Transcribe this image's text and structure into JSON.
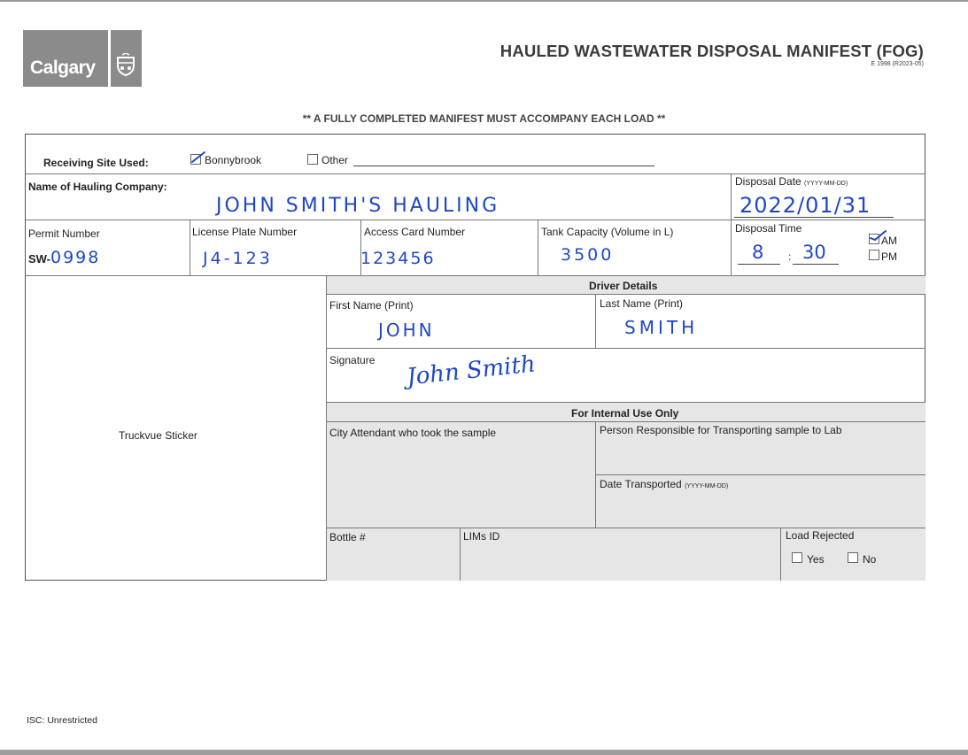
{
  "header": {
    "logo_text": "Calgary",
    "title": "HAULED WASTEWATER DISPOSAL MANIFEST (FOG)",
    "form_code": "E 1998 (R2023-05)",
    "notice": "** A FULLY COMPLETED MANIFEST MUST ACCOMPANY EACH LOAD **"
  },
  "receiving": {
    "label": "Receiving Site Used:",
    "option_bonnybrook": "Bonnybrook",
    "bonnybrook_checked": true,
    "option_other": "Other",
    "other_checked": false
  },
  "hauling": {
    "label": "Name of Hauling Company:",
    "value": "JOHN SMITH'S HAULING"
  },
  "disposal_date": {
    "label": "Disposal Date",
    "format": "(YYYY-MM-DD)",
    "value": "2022/01/31"
  },
  "permit": {
    "label": "Permit Number",
    "prefix": "SW-",
    "value": "0998"
  },
  "license": {
    "label": "License Plate Number",
    "value": "J4-123"
  },
  "access_card": {
    "label": "Access Card Number",
    "value": "123456"
  },
  "tank": {
    "label": "Tank Capacity (Volume in L)",
    "value": "3500"
  },
  "disposal_time": {
    "label": "Disposal Time",
    "hour": "8",
    "separator": ":",
    "minute": "30",
    "am_label": "AM",
    "pm_label": "PM",
    "am_checked": true
  },
  "truckvue": {
    "label": "Truckvue Sticker"
  },
  "driver": {
    "section_label": "Driver Details",
    "first_label": "First Name (Print)",
    "first_value": "JOHN",
    "last_label": "Last Name (Print)",
    "last_value": "SMITH",
    "signature_label": "Signature",
    "signature_value": "John Smith"
  },
  "internal": {
    "section_label": "For Internal Use Only",
    "attendant_label": "City Attendant who took the sample",
    "transport_label": "Person Responsible for Transporting sample to Lab",
    "date_transported_label": "Date Transported",
    "date_transported_format": "(YYYY-MM-DD)",
    "bottle_label": "Bottle #",
    "lims_label": "LIMs ID",
    "rejected_label": "Load Rejected",
    "yes_label": "Yes",
    "no_label": "No"
  },
  "footer": {
    "classification": "ISC: Unrestricted"
  },
  "colors": {
    "ink": "#1f47c4",
    "shade": "#e6e6e6",
    "logo_bg": "#8b8b8b"
  }
}
